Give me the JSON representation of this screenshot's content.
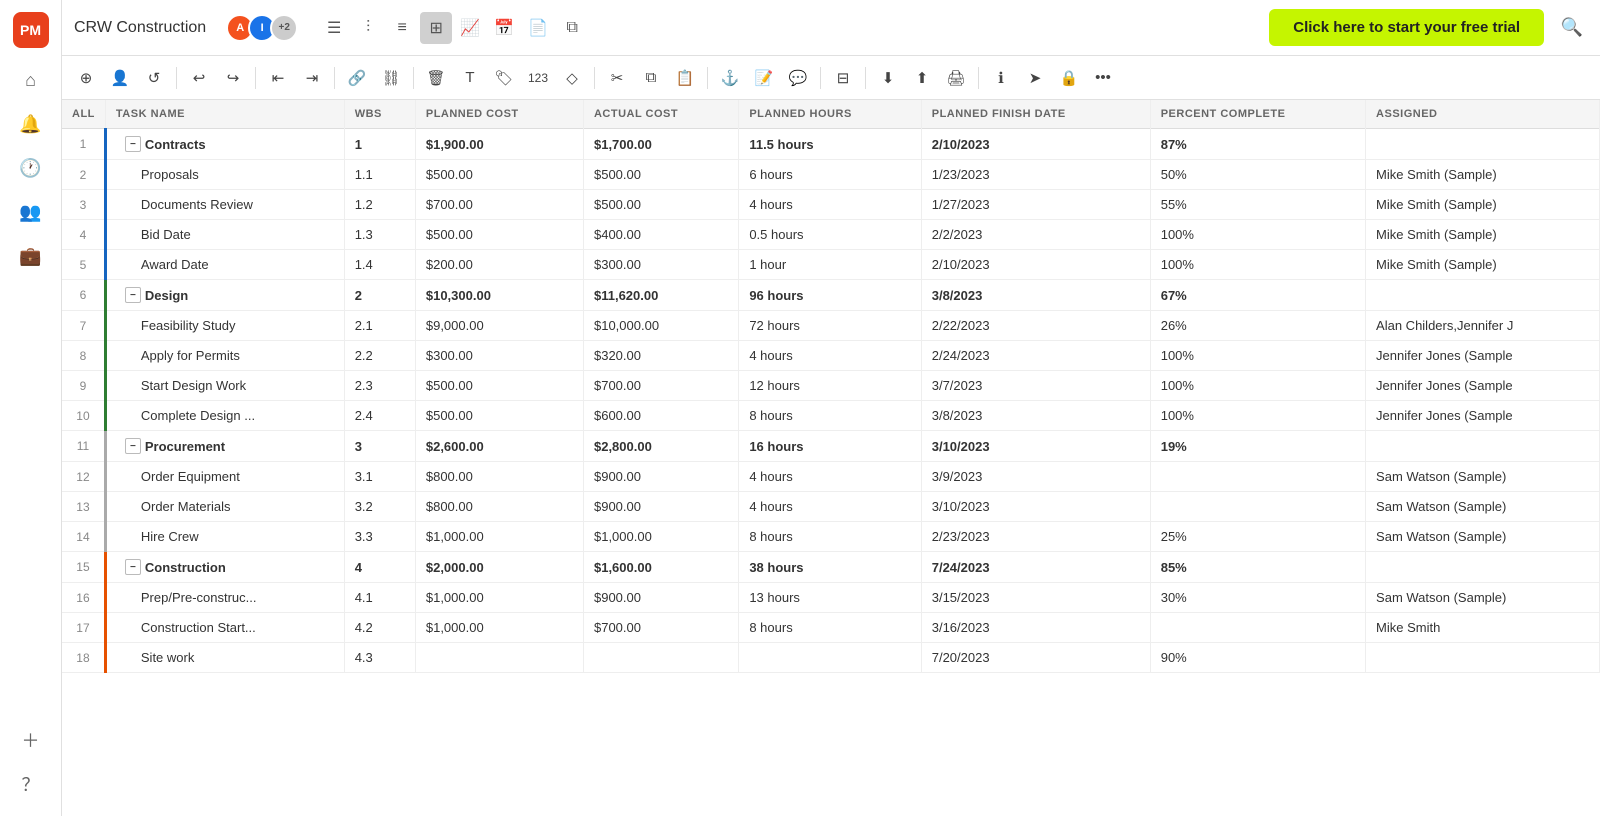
{
  "app": {
    "logo": "PM",
    "project_title": "CRW Construction",
    "free_trial_label": "Click here to start your free trial"
  },
  "avatars": [
    {
      "initials": "A",
      "color": "#f4511e"
    },
    {
      "initials": "I",
      "color": "#1a73e8"
    },
    {
      "initials": "+2",
      "color": "#ccc"
    }
  ],
  "columns": [
    {
      "key": "num",
      "label": "ALL"
    },
    {
      "key": "task_name",
      "label": "TASK NAME"
    },
    {
      "key": "wbs",
      "label": "WBS"
    },
    {
      "key": "planned_cost",
      "label": "PLANNED COST"
    },
    {
      "key": "actual_cost",
      "label": "ACTUAL COST"
    },
    {
      "key": "planned_hours",
      "label": "PLANNED HOURS"
    },
    {
      "key": "planned_finish",
      "label": "PLANNED FINISH DATE"
    },
    {
      "key": "percent",
      "label": "PERCENT COMPLETE"
    },
    {
      "key": "assigned",
      "label": "ASSIGNED"
    }
  ],
  "rows": [
    {
      "num": "1",
      "type": "group",
      "group": 1,
      "task": "Contracts",
      "wbs": "1",
      "planned_cost": "$1,900.00",
      "actual_cost": "$1,700.00",
      "hours": "11.5 hours",
      "finish": "2/10/2023",
      "percent": "87%",
      "assigned": ""
    },
    {
      "num": "2",
      "type": "child",
      "group": 1,
      "task": "Proposals",
      "wbs": "1.1",
      "planned_cost": "$500.00",
      "actual_cost": "$500.00",
      "hours": "6 hours",
      "finish": "1/23/2023",
      "percent": "50%",
      "assigned": "Mike Smith (Sample)"
    },
    {
      "num": "3",
      "type": "child",
      "group": 1,
      "task": "Documents Review",
      "wbs": "1.2",
      "planned_cost": "$700.00",
      "actual_cost": "$500.00",
      "hours": "4 hours",
      "finish": "1/27/2023",
      "percent": "55%",
      "assigned": "Mike Smith (Sample)"
    },
    {
      "num": "4",
      "type": "child",
      "group": 1,
      "task": "Bid Date",
      "wbs": "1.3",
      "planned_cost": "$500.00",
      "actual_cost": "$400.00",
      "hours": "0.5 hours",
      "finish": "2/2/2023",
      "percent": "100%",
      "assigned": "Mike Smith (Sample)"
    },
    {
      "num": "5",
      "type": "child",
      "group": 1,
      "task": "Award Date",
      "wbs": "1.4",
      "planned_cost": "$200.00",
      "actual_cost": "$300.00",
      "hours": "1 hour",
      "finish": "2/10/2023",
      "percent": "100%",
      "assigned": "Mike Smith (Sample)"
    },
    {
      "num": "6",
      "type": "group",
      "group": 2,
      "task": "Design",
      "wbs": "2",
      "planned_cost": "$10,300.00",
      "actual_cost": "$11,620.00",
      "hours": "96 hours",
      "finish": "3/8/2023",
      "percent": "67%",
      "assigned": ""
    },
    {
      "num": "7",
      "type": "child",
      "group": 2,
      "task": "Feasibility Study",
      "wbs": "2.1",
      "planned_cost": "$9,000.00",
      "actual_cost": "$10,000.00",
      "hours": "72 hours",
      "finish": "2/22/2023",
      "percent": "26%",
      "assigned": "Alan Childers,Jennifer J"
    },
    {
      "num": "8",
      "type": "child",
      "group": 2,
      "task": "Apply for Permits",
      "wbs": "2.2",
      "planned_cost": "$300.00",
      "actual_cost": "$320.00",
      "hours": "4 hours",
      "finish": "2/24/2023",
      "percent": "100%",
      "assigned": "Jennifer Jones (Sample"
    },
    {
      "num": "9",
      "type": "child",
      "group": 2,
      "task": "Start Design Work",
      "wbs": "2.3",
      "planned_cost": "$500.00",
      "actual_cost": "$700.00",
      "hours": "12 hours",
      "finish": "3/7/2023",
      "percent": "100%",
      "assigned": "Jennifer Jones (Sample"
    },
    {
      "num": "10",
      "type": "child",
      "group": 2,
      "task": "Complete Design ...",
      "wbs": "2.4",
      "planned_cost": "$500.00",
      "actual_cost": "$600.00",
      "hours": "8 hours",
      "finish": "3/8/2023",
      "percent": "100%",
      "assigned": "Jennifer Jones (Sample"
    },
    {
      "num": "11",
      "type": "group",
      "group": 3,
      "task": "Procurement",
      "wbs": "3",
      "planned_cost": "$2,600.00",
      "actual_cost": "$2,800.00",
      "hours": "16 hours",
      "finish": "3/10/2023",
      "percent": "19%",
      "assigned": ""
    },
    {
      "num": "12",
      "type": "child",
      "group": 3,
      "task": "Order Equipment",
      "wbs": "3.1",
      "planned_cost": "$800.00",
      "actual_cost": "$900.00",
      "hours": "4 hours",
      "finish": "3/9/2023",
      "percent": "",
      "assigned": "Sam Watson (Sample)"
    },
    {
      "num": "13",
      "type": "child",
      "group": 3,
      "task": "Order Materials",
      "wbs": "3.2",
      "planned_cost": "$800.00",
      "actual_cost": "$900.00",
      "hours": "4 hours",
      "finish": "3/10/2023",
      "percent": "",
      "assigned": "Sam Watson (Sample)"
    },
    {
      "num": "14",
      "type": "child",
      "group": 3,
      "task": "Hire Crew",
      "wbs": "3.3",
      "planned_cost": "$1,000.00",
      "actual_cost": "$1,000.00",
      "hours": "8 hours",
      "finish": "2/23/2023",
      "percent": "25%",
      "assigned": "Sam Watson (Sample)"
    },
    {
      "num": "15",
      "type": "group",
      "group": 4,
      "task": "Construction",
      "wbs": "4",
      "planned_cost": "$2,000.00",
      "actual_cost": "$1,600.00",
      "hours": "38 hours",
      "finish": "7/24/2023",
      "percent": "85%",
      "assigned": ""
    },
    {
      "num": "16",
      "type": "child",
      "group": 4,
      "task": "Prep/Pre-construc...",
      "wbs": "4.1",
      "planned_cost": "$1,000.00",
      "actual_cost": "$900.00",
      "hours": "13 hours",
      "finish": "3/15/2023",
      "percent": "30%",
      "assigned": "Sam Watson (Sample)"
    },
    {
      "num": "17",
      "type": "child",
      "group": 4,
      "task": "Construction Start...",
      "wbs": "4.2",
      "planned_cost": "$1,000.00",
      "actual_cost": "$700.00",
      "hours": "8 hours",
      "finish": "3/16/2023",
      "percent": "",
      "assigned": "Mike Smith"
    },
    {
      "num": "18",
      "type": "child",
      "group": 4,
      "task": "Site work",
      "wbs": "4.3",
      "planned_cost": "",
      "actual_cost": "",
      "hours": "",
      "finish": "7/20/2023",
      "percent": "90%",
      "assigned": ""
    }
  ],
  "sidebar_icons": [
    "home",
    "activity",
    "clock",
    "users",
    "briefcase"
  ],
  "toolbar_groups": [
    [
      "plus",
      "user-plus",
      "refresh"
    ],
    [
      "undo",
      "redo"
    ],
    [
      "indent-left",
      "indent-right"
    ],
    [
      "link",
      "link-2"
    ],
    [
      "trash",
      "type",
      "tag",
      "123",
      "diamond"
    ],
    [
      "scissors",
      "copy",
      "clipboard"
    ],
    [
      "anchor",
      "file-text",
      "message-square"
    ],
    [
      "columns"
    ],
    [
      "download",
      "upload",
      "printer"
    ],
    [
      "info",
      "send",
      "lock",
      "more-horizontal"
    ]
  ]
}
